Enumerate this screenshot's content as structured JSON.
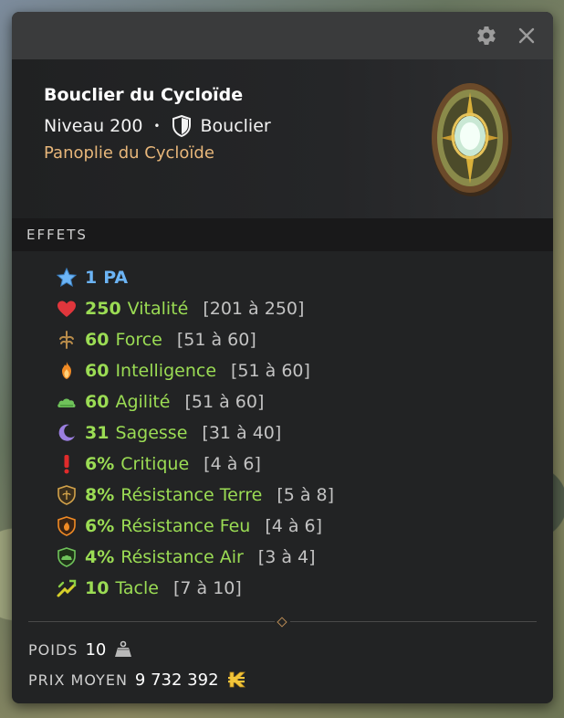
{
  "window": {
    "settings_icon": "gear-icon",
    "close_icon": "close-icon"
  },
  "item": {
    "name": "Bouclier du Cycloïde",
    "level": "Niveau 200",
    "separator": "•",
    "type": "Bouclier",
    "type_icon": "shield-icon",
    "set": "Panoplie du Cycloïde",
    "set_color": "#e8b77a"
  },
  "effects": {
    "title": "EFFETS",
    "items": [
      {
        "icon": "ap-star-icon",
        "value": "1",
        "name": "PA",
        "range": "",
        "color": "#6cb4f5"
      },
      {
        "icon": "vitality-heart-icon",
        "value": "250",
        "name": "Vitalité",
        "range": "[201 à 250]",
        "color": "#9bdc54"
      },
      {
        "icon": "strength-icon",
        "value": "60",
        "name": "Force",
        "range": "[51 à 60]",
        "color": "#9bdc54"
      },
      {
        "icon": "intelligence-flame-icon",
        "value": "60",
        "name": "Intelligence",
        "range": "[51 à 60]",
        "color": "#9bdc54"
      },
      {
        "icon": "agility-cloud-icon",
        "value": "60",
        "name": "Agilité",
        "range": "[51 à 60]",
        "color": "#9bdc54"
      },
      {
        "icon": "wisdom-moon-icon",
        "value": "31",
        "name": "Sagesse",
        "range": "[31 à 40]",
        "color": "#9bdc54"
      },
      {
        "icon": "critical-icon",
        "value": "6%",
        "name": "Critique",
        "range": "[4 à 6]",
        "color": "#9bdc54"
      },
      {
        "icon": "earth-resistance-icon",
        "value": "8%",
        "name": "Résistance Terre",
        "range": "[5 à 8]",
        "color": "#9bdc54"
      },
      {
        "icon": "fire-resistance-icon",
        "value": "6%",
        "name": "Résistance Feu",
        "range": "[4 à 6]",
        "color": "#9bdc54"
      },
      {
        "icon": "air-resistance-icon",
        "value": "4%",
        "name": "Résistance Air",
        "range": "[3 à 4]",
        "color": "#9bdc54"
      },
      {
        "icon": "lock-tackle-icon",
        "value": "10",
        "name": "Tacle",
        "range": "[7 à 10]",
        "color": "#9bdc54"
      }
    ]
  },
  "footer": {
    "weight_label": "POIDS",
    "weight_value": "10",
    "weight_icon": "weight-icon",
    "price_label": "PRIX MOYEN",
    "price_value": "9 732 392",
    "price_icon": "kamas-icon"
  }
}
